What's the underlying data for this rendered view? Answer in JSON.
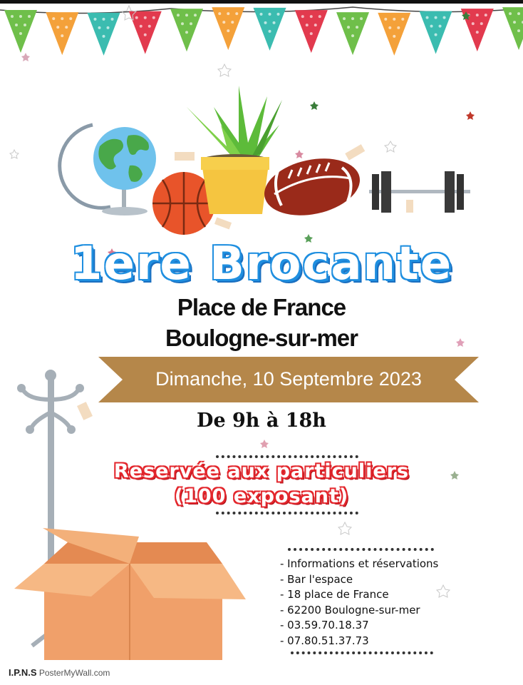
{
  "poster": {
    "title": "1ere Brocante",
    "venue_line1": "Place de France",
    "venue_line2": "Boulogne-sur-mer",
    "date": "Dimanche, 10 Septembre 2023",
    "hours": "De 9h à 18h",
    "reserved_line1": "Reservée aux particuliers",
    "reserved_line2": "(100 exposant)",
    "info_lines": [
      "- Informations et réservations",
      "- Bar l'espace",
      "- 18 place de France",
      "- 62200 Boulogne-sur-mer",
      "- 03.59.70.18.37",
      "- 07.80.51.37.73"
    ],
    "credit_brand": "I.P.N.S",
    "credit_text": "PosterMyWall.com"
  },
  "colors": {
    "title_blue": "#1f8fe0",
    "reserve_red": "#e3262c",
    "ribbon_brown": "#b5874a",
    "flag_green": "#6fbf4a",
    "flag_orange": "#f4a13a",
    "flag_teal": "#3bbcb0",
    "flag_red": "#e23a4e",
    "box_orange": "#f2a66e"
  },
  "icons": [
    "globe-icon",
    "basketball-icon",
    "plant-pot-icon",
    "football-icon",
    "dumbbell-icon",
    "coat-rack-icon",
    "cardboard-box-icon",
    "star-icon"
  ]
}
